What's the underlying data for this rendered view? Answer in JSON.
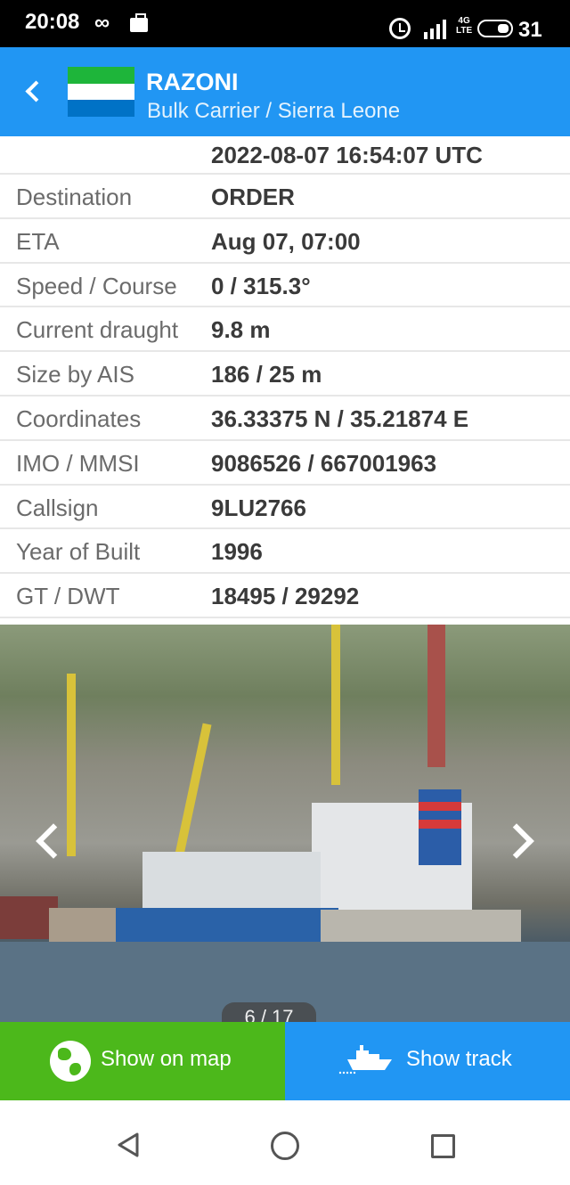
{
  "status_bar": {
    "time": "20:08",
    "network": "4G\nLTE",
    "battery_level": "31"
  },
  "app_bar": {
    "vessel_name": "RAZONI",
    "subtitle": "Bulk Carrier / Sierra Leone",
    "flag_colors": [
      "#1eb53a",
      "#ffffff",
      "#0072c6"
    ]
  },
  "details": {
    "partial_row": {
      "value": "2022-08-07 16:54:07 UTC"
    },
    "rows": [
      {
        "label": "Destination",
        "value": "ORDER"
      },
      {
        "label": "ETA",
        "value": "Aug 07, 07:00"
      },
      {
        "label": "Speed / Course",
        "value": "0 / 315.3°"
      },
      {
        "label": "Current draught",
        "value": "9.8 m"
      },
      {
        "label": "Size by AIS",
        "value": "186 / 25 m"
      },
      {
        "label": "Coordinates",
        "value": "36.33375 N / 35.21874 E"
      },
      {
        "label": "IMO / MMSI",
        "value": "9086526 / 667001963"
      },
      {
        "label": "Callsign",
        "value": "9LU2766"
      },
      {
        "label": "Year of Built",
        "value": "1996"
      },
      {
        "label": "GT / DWT",
        "value": "18495 / 29292"
      }
    ]
  },
  "gallery": {
    "counter": "6 / 17"
  },
  "actions": {
    "show_on_map": "Show on map",
    "show_track": "Show track",
    "map_color": "#4cb81b",
    "track_color": "#2196f3"
  },
  "icons": {
    "back": "chevron-left-icon",
    "map": "globe-icon",
    "track": "ship-icon"
  }
}
